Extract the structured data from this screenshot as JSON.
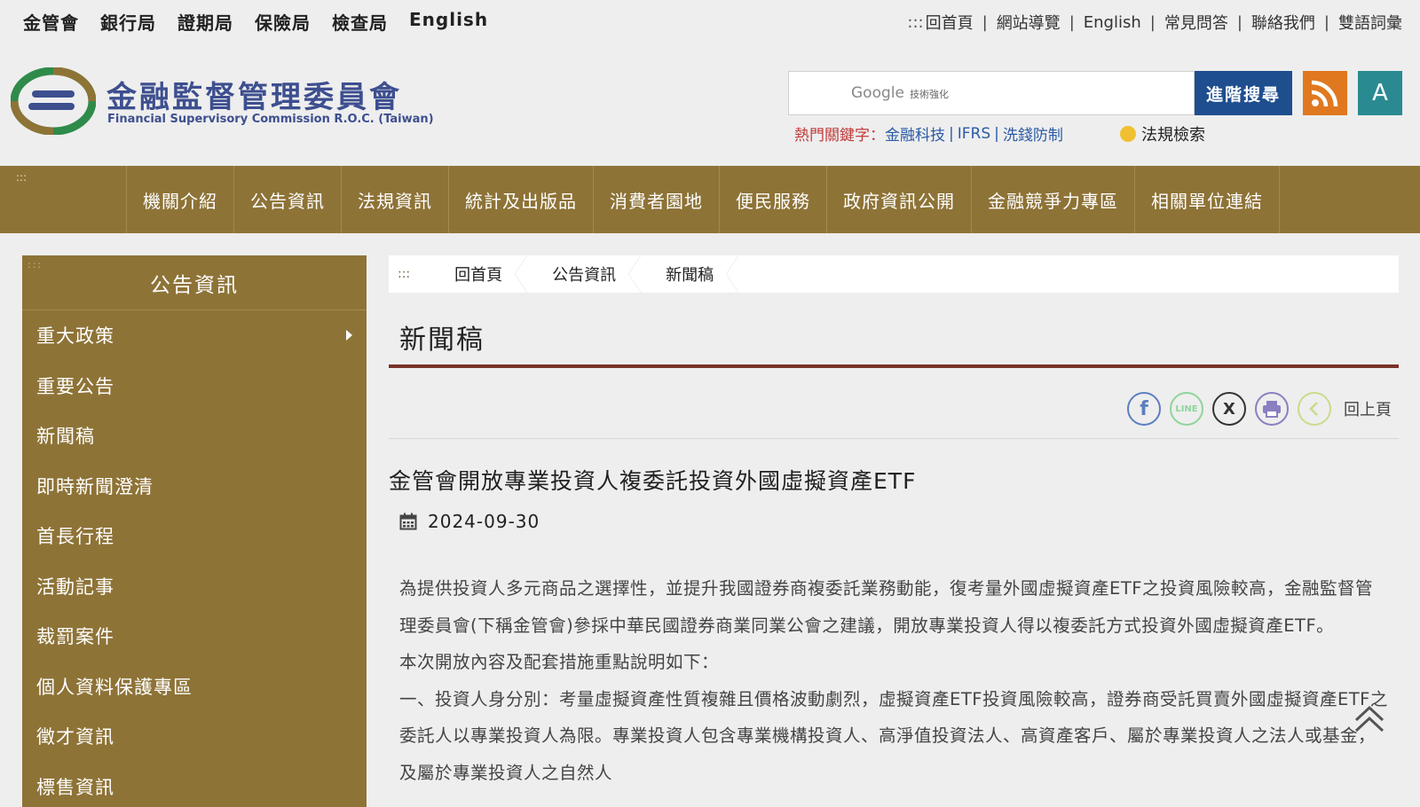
{
  "top_links": [
    "金管會",
    "銀行局",
    "證期局",
    "保險局",
    "檢查局",
    "English"
  ],
  "utility": {
    "lead": ":::",
    "links": [
      "回首頁",
      "網站導覽",
      "English",
      "常見問答",
      "聯絡我們",
      "雙語詞彙"
    ]
  },
  "logo": {
    "zh": "金融監督管理委員會",
    "en": "Financial Supervisory Commission R.O.C. (Taiwan)"
  },
  "search": {
    "google_label": "Google",
    "google_sub": "技術強化",
    "button_label": "進階搜尋",
    "rss_icon": "rss-icon",
    "font_size_label": "A"
  },
  "hot_keywords": {
    "label": "熱門關鍵字：",
    "items": [
      "金融科技",
      "IFRS",
      "洗錢防制"
    ]
  },
  "law_search": "法規檢索",
  "nav": {
    "mark": ":::",
    "items": [
      "機關介紹",
      "公告資訊",
      "法規資訊",
      "統計及出版品",
      "消費者園地",
      "便民服務",
      "政府資訊公開",
      "金融競爭力專區",
      "相關單位連結"
    ]
  },
  "sidebar": {
    "mark": ":::",
    "title": "公告資訊",
    "items": [
      "重大政策",
      "重要公告",
      "新聞稿",
      "即時新聞澄清",
      "首長行程",
      "活動記事",
      "裁罰案件",
      "個人資料保護專區",
      "徵才資訊",
      "標售資訊"
    ]
  },
  "breadcrumb": {
    "mark": ":::",
    "items": [
      "回首頁",
      "公告資訊",
      "新聞稿"
    ]
  },
  "page_title": "新聞稿",
  "share": {
    "facebook": "f",
    "line": "LINE",
    "x": "X",
    "back_label": "回上頁"
  },
  "article": {
    "title": "金管會開放專業投資人複委託投資外國虛擬資產ETF",
    "date": "2024-09-30",
    "paragraphs": [
      "為提供投資人多元商品之選擇性，並提升我國證券商複委託業務動能，復考量外國虛擬資產ETF之投資風險較高，金融監督管理委員會(下稱金管會)參採中華民國證券商業同業公會之建議，開放專業投資人得以複委託方式投資外國虛擬資產ETF。",
      "本次開放內容及配套措施重點說明如下：",
      "一、投資人身分別：考量虛擬資產性質複雜且價格波動劇烈，虛擬資產ETF投資風險較高，證券商受託買賣外國虛擬資產ETF之委託人以專業投資人為限。專業投資人包含專業機構投資人、高淨值投資法人、高資產客戶、屬於專業投資人之法人或基金，及屬於專業投資人之自然人"
    ]
  },
  "colors": {
    "nav_bg": "#8e7337",
    "accent_red": "#7a3328",
    "search_btn": "#1f4e8f",
    "rss": "#e07820",
    "font_btn": "#2a8a92",
    "logo_text": "#3d4f8f"
  }
}
